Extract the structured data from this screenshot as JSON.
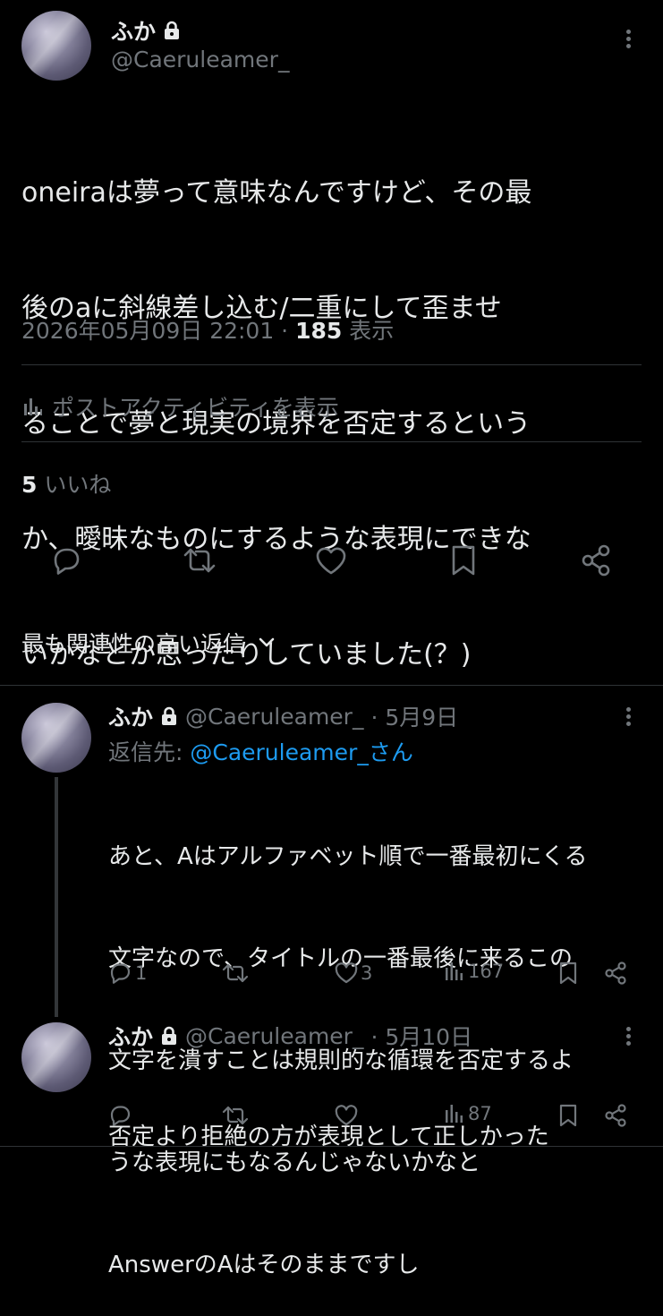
{
  "main_post": {
    "display_name": "ふか",
    "handle": "@Caeruleamer_",
    "text_lines": [
      "oneiraは夢って意味なんですけど、その最",
      "後のaに斜線差し込む/二重にして歪ませ",
      "ることで夢と現実の境界を否定するという",
      "か、曖昧なものにするような表現にできな",
      "いかなとか思ったりしていました(？)"
    ],
    "timestamp": "2026年05月09日 22:01 ·",
    "views_count": "185",
    "views_label": "表示",
    "activity_label": "ポストアクティビティを表示",
    "likes_count": "5",
    "likes_label": "いいね"
  },
  "sort": {
    "label": "最も関連性の高い返信"
  },
  "replies": [
    {
      "display_name": "ふか",
      "handle": "@Caeruleamer_",
      "date": "· 5月9日",
      "reply_to_label": "返信先: ",
      "reply_to_handle": "@Caeruleamer_さん",
      "text_lines": [
        "あと、Aはアルファベット順で一番最初にくる",
        "文字なので、タイトルの一番最後に来るこの",
        "文字を潰すことは規則的な循環を否定するよ",
        "うな表現にもなるんじゃないかなと",
        "AnswerのAはそのままですし"
      ],
      "reply_count": "1",
      "like_count": "3",
      "view_count": "167"
    },
    {
      "display_name": "ふか",
      "handle": "@Caeruleamer_",
      "date": "· 5月10日",
      "text_lines": [
        "否定より拒絶の方が表現として正しかった"
      ],
      "view_count": "87"
    }
  ],
  "colors": {
    "background": "#000000",
    "text": "#e7e9ea",
    "muted": "#71767b",
    "link": "#1d9bf0",
    "divider": "#2f3336"
  },
  "icons": [
    "lock-icon",
    "more-icon",
    "reply-icon",
    "repost-icon",
    "like-icon",
    "bookmark-icon",
    "share-icon",
    "analytics-icon",
    "chevron-down-icon"
  ]
}
